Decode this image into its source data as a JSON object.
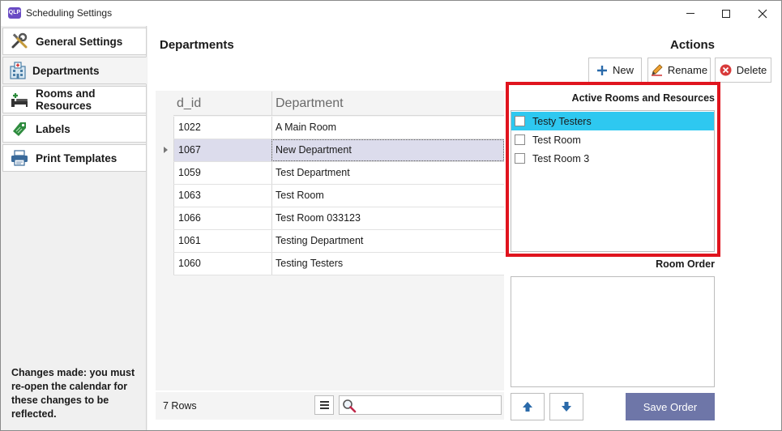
{
  "window": {
    "title": "Scheduling Settings",
    "app_icon_text": "QLP"
  },
  "sidebar": {
    "items": [
      {
        "label": "General Settings",
        "icon": "tools-icon"
      },
      {
        "label": "Departments",
        "icon": "hospital-icon"
      },
      {
        "label": "Rooms and Resources",
        "icon": "bed-icon"
      },
      {
        "label": "Labels",
        "icon": "tag-icon"
      },
      {
        "label": "Print Templates",
        "icon": "printer-icon"
      }
    ],
    "active_index": 1,
    "note": "Changes made: you must re-open the calendar for these changes to be reflected."
  },
  "main": {
    "departments_heading": "Departments",
    "actions_heading": "Actions",
    "actions": {
      "new_label": "New",
      "rename_label": "Rename",
      "delete_label": "Delete"
    },
    "grid": {
      "columns": [
        "d_id",
        "Department"
      ],
      "rows": [
        {
          "d_id": "1022",
          "department": "A Main Room"
        },
        {
          "d_id": "1067",
          "department": "New Department"
        },
        {
          "d_id": "1059",
          "department": "Test Department"
        },
        {
          "d_id": "1063",
          "department": "Test Room"
        },
        {
          "d_id": "1066",
          "department": "Test Room 033123"
        },
        {
          "d_id": "1061",
          "department": "Testing Department"
        },
        {
          "d_id": "1060",
          "department": "Testing Testers"
        }
      ],
      "selected_row_index": 1,
      "row_count_label": "7 Rows",
      "search": {
        "value": "",
        "placeholder": ""
      }
    },
    "active_rooms": {
      "label": "Active Rooms and Resources",
      "items": [
        {
          "label": "Testy Testers",
          "checked": false,
          "highlighted": true
        },
        {
          "label": "Test Room",
          "checked": false,
          "highlighted": false
        },
        {
          "label": "Test Room 3",
          "checked": false,
          "highlighted": false
        }
      ]
    },
    "room_order": {
      "label": "Room Order",
      "items": []
    },
    "save_order_label": "Save Order"
  },
  "colors": {
    "highlight": "#2ec8f0",
    "selected_row": "#dcdcec",
    "save_button": "#6e76a8",
    "emphasis_frame": "#e0141e"
  }
}
